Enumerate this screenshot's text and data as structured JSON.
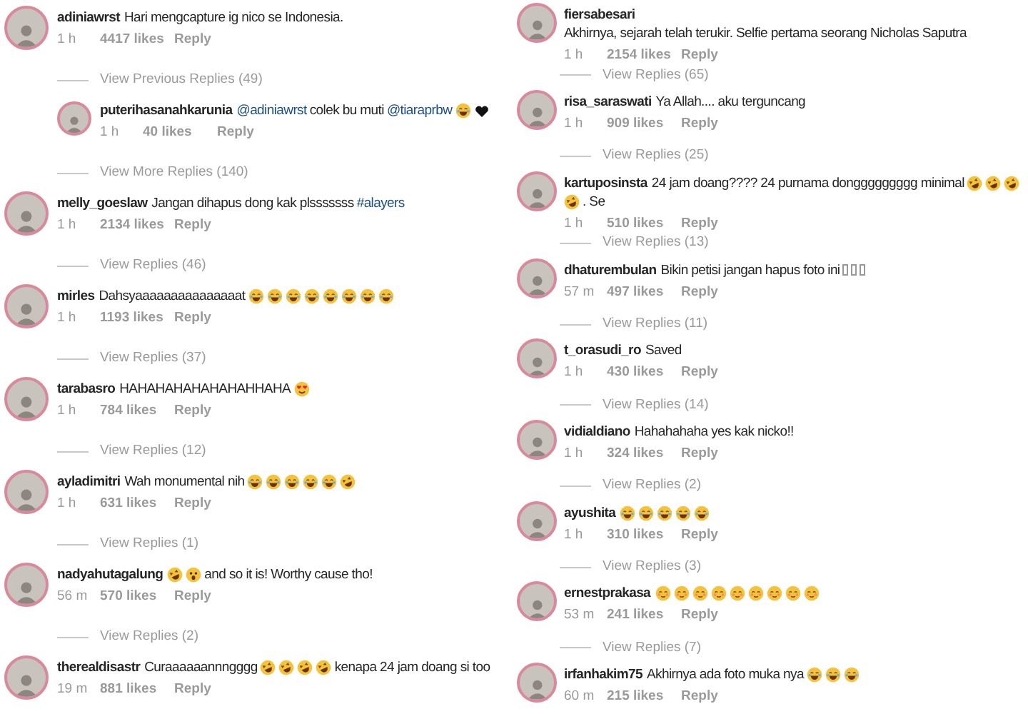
{
  "columns": [
    {
      "comments": [
        {
          "username": "adiniawrst",
          "parts": [
            {
              "kind": "text",
              "text": "Hari mengcapture ig nico se Indonesia."
            }
          ],
          "time": "1 h",
          "likes": "4417 likes",
          "reply": "Reply",
          "previous_replies_link": "View Previous Replies (49)",
          "replies": [
            {
              "username": "puterihasanahkarunia",
              "parts": [
                {
                  "kind": "link",
                  "text": "@adiniawrst"
                },
                {
                  "kind": "text",
                  "text": "colek bu muti"
                },
                {
                  "kind": "link",
                  "text": "@tiaraprbw"
                },
                {
                  "kind": "joy"
                },
                {
                  "kind": "black-heart"
                }
              ],
              "time": "1 h",
              "likes": "40 likes",
              "reply": "Reply"
            }
          ],
          "replies_link": "View More Replies (140)"
        },
        {
          "username": "melly_goeslaw",
          "parts": [
            {
              "kind": "text",
              "text": "Jangan dihapus dong kak plsssssss"
            },
            {
              "kind": "link",
              "text": "#alayers"
            }
          ],
          "time": "1 h",
          "likes": "2134 likes",
          "reply": "Reply",
          "replies_link": "View Replies (46)"
        },
        {
          "username": "mirles",
          "parts": [
            {
              "kind": "text",
              "text": "Dahsyaaaaaaaaaaaaaaat"
            },
            {
              "kind": "joy"
            },
            {
              "kind": "joy"
            },
            {
              "kind": "joy"
            },
            {
              "kind": "joy"
            },
            {
              "kind": "joy"
            },
            {
              "kind": "joy"
            },
            {
              "kind": "joy"
            },
            {
              "kind": "joy"
            }
          ],
          "time": "1 h",
          "likes": "1193 likes",
          "reply": "Reply",
          "replies_link": "View Replies (37)"
        },
        {
          "username": "tarabasro",
          "parts": [
            {
              "kind": "text",
              "text": "HAHAHAHAHAHAHAHHAHA"
            },
            {
              "kind": "heart-eyes"
            }
          ],
          "time": "1 h",
          "likes": "784 likes",
          "reply": "Reply",
          "replies_link": "View Replies (12)"
        },
        {
          "username": "ayladimitri",
          "parts": [
            {
              "kind": "text",
              "text": "Wah monumental nih"
            },
            {
              "kind": "joy"
            },
            {
              "kind": "joy"
            },
            {
              "kind": "joy"
            },
            {
              "kind": "joy"
            },
            {
              "kind": "joy"
            },
            {
              "kind": "rolling"
            }
          ],
          "time": "1 h",
          "likes": "631 likes",
          "reply": "Reply",
          "replies_link": "View Replies (1)"
        },
        {
          "username": "nadyahutagalung",
          "parts": [
            {
              "kind": "rolling"
            },
            {
              "kind": "astonished"
            },
            {
              "kind": "text",
              "text": "and so it is! Worthy cause tho!"
            }
          ],
          "time": "56 m",
          "likes": "570 likes",
          "reply": "Reply",
          "replies_link": "View Replies (2)"
        },
        {
          "username": "therealdisastr",
          "parts": [
            {
              "kind": "text",
              "text": "Curaaaaaannngggg"
            },
            {
              "kind": "rolling"
            },
            {
              "kind": "rolling"
            },
            {
              "kind": "rolling"
            },
            {
              "kind": "rolling"
            },
            {
              "kind": "text",
              "text": "kenapa 24 jam doang si too"
            }
          ],
          "time": "19 m",
          "likes": "881 likes",
          "reply": "Reply"
        }
      ]
    },
    {
      "comments": [
        {
          "username": "fiersabesari",
          "parts": [
            {
              "kind": "text",
              "text": "Akhirnya, sejarah telah terukir. Selfie pertama seorang Nicholas Saputra"
            }
          ],
          "time": "1 h",
          "likes": "2154 likes",
          "reply": "Reply",
          "replies_link": "View Replies (65)"
        },
        {
          "username": "risa_saraswati",
          "parts": [
            {
              "kind": "text",
              "text": "Ya Allah.... aku terguncang"
            }
          ],
          "time": "1 h",
          "likes": "909 likes",
          "reply": "Reply",
          "replies_link": "View Replies (25)"
        },
        {
          "username": "kartuposinsta",
          "parts": [
            {
              "kind": "text",
              "text": "24 jam doang???? 24 purnama donggggggggg minimal"
            },
            {
              "kind": "rolling"
            },
            {
              "kind": "rolling"
            },
            {
              "kind": "rolling"
            },
            {
              "kind": "rolling"
            },
            {
              "kind": "text",
              "text": ". Se"
            }
          ],
          "time": "1 h",
          "likes": "510 likes",
          "reply": "Reply",
          "replies_link": "View Replies (13)"
        },
        {
          "username": "dhaturembulan",
          "parts": [
            {
              "kind": "text",
              "text": "Bikin petisi jangan hapus foto ini"
            },
            {
              "kind": "missing-glyph"
            },
            {
              "kind": "missing-glyph"
            },
            {
              "kind": "missing-glyph"
            }
          ],
          "time": "57 m",
          "likes": "497 likes",
          "reply": "Reply",
          "replies_link": "View Replies (11)"
        },
        {
          "username": "t_orasudi_ro",
          "parts": [
            {
              "kind": "text",
              "text": "Saved"
            }
          ],
          "time": "1 h",
          "likes": "430 likes",
          "reply": "Reply",
          "replies_link": "View Replies (14)"
        },
        {
          "username": "vidialdiano",
          "parts": [
            {
              "kind": "text",
              "text": "Hahahahaha yes kak nicko!!"
            }
          ],
          "time": "1 h",
          "likes": "324 likes",
          "reply": "Reply",
          "replies_link": "View Replies (2)"
        },
        {
          "username": "ayushita",
          "parts": [
            {
              "kind": "joy"
            },
            {
              "kind": "joy"
            },
            {
              "kind": "joy"
            },
            {
              "kind": "joy"
            },
            {
              "kind": "joy"
            }
          ],
          "time": "1 h",
          "likes": "310 likes",
          "reply": "Reply",
          "replies_link": "View Replies (3)"
        },
        {
          "username": "ernestprakasa",
          "parts": [
            {
              "kind": "blush"
            },
            {
              "kind": "blush"
            },
            {
              "kind": "blush"
            },
            {
              "kind": "blush"
            },
            {
              "kind": "blush"
            },
            {
              "kind": "blush"
            },
            {
              "kind": "blush"
            },
            {
              "kind": "blush"
            },
            {
              "kind": "blush"
            }
          ],
          "time": "53 m",
          "likes": "241 likes",
          "reply": "Reply",
          "replies_link": "View Replies (7)"
        },
        {
          "username": "irfanhakim75",
          "parts": [
            {
              "kind": "text",
              "text": "Akhirnya ada foto muka nya"
            },
            {
              "kind": "joy"
            },
            {
              "kind": "joy"
            },
            {
              "kind": "joy"
            }
          ],
          "time": "60 m",
          "likes": "215 likes",
          "reply": "Reply"
        }
      ]
    }
  ]
}
